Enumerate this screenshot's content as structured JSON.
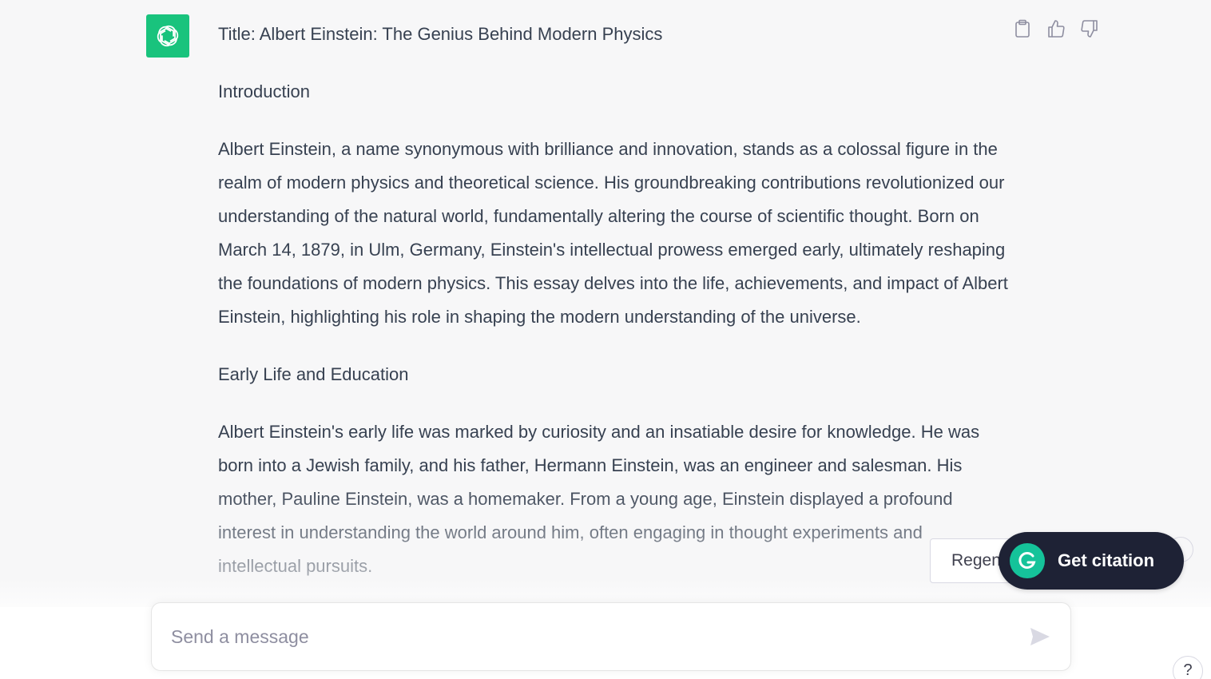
{
  "assistant": {
    "avatar_icon": "openai-logo-icon",
    "avatar_color": "#19c37d"
  },
  "message": {
    "title": "Title: Albert Einstein: The Genius Behind Modern Physics",
    "heading_intro": "Introduction",
    "intro_paragraph": "Albert Einstein, a name synonymous with brilliance and innovation, stands as a colossal figure in the realm of modern physics and theoretical science. His groundbreaking contributions revolutionized our understanding of the natural world, fundamentally altering the course of scientific thought. Born on March 14, 1879, in Ulm, Germany, Einstein's intellectual prowess emerged early, ultimately reshaping the foundations of modern physics. This essay delves into the life, achievements, and impact of Albert Einstein, highlighting his role in shaping the modern understanding of the universe.",
    "heading_early": "Early Life and Education",
    "early_paragraph": "Albert Einstein's early life was marked by curiosity and an insatiable desire for knowledge. He was born into a Jewish family, and his father, Hermann Einstein, was an engineer and salesman. His mother, Pauline Einstein, was a homemaker. From a young age, Einstein displayed a profound interest in understanding the world around him, often engaging in thought experiments and intellectual pursuits."
  },
  "feedback": {
    "copy_icon": "clipboard-icon",
    "like_icon": "thumbs-up-icon",
    "dislike_icon": "thumbs-down-icon"
  },
  "regenerate": {
    "label": "Regenerate response",
    "icon": "refresh-icon"
  },
  "citation": {
    "label": "Get citation",
    "icon": "grammarly-logo-icon",
    "bg_color": "#1e2235",
    "logo_color": "#15c39a"
  },
  "composer": {
    "placeholder": "Send a message",
    "send_icon": "send-icon"
  },
  "help": {
    "label": "?"
  }
}
